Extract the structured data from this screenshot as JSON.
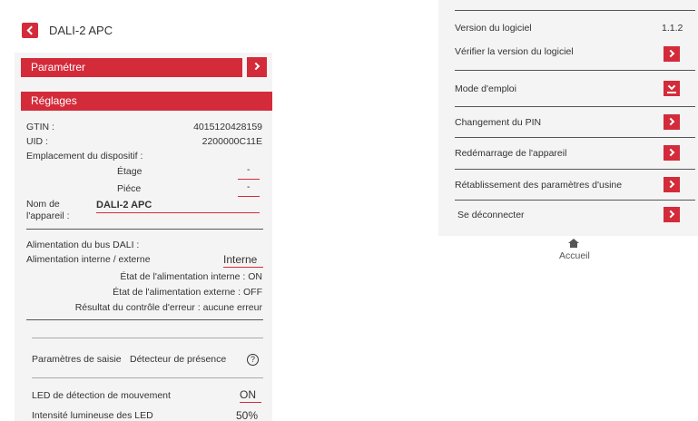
{
  "header": {
    "title": "DALI-2 APC"
  },
  "sections": {
    "parametrer": "Paramétrer",
    "reglages": "Réglages"
  },
  "info": {
    "gtin_label": "GTIN :",
    "gtin_value": "4015120428159",
    "uid_label": "UID :",
    "uid_value": "2200000C11E",
    "location_label": "Emplacement du dispositif :",
    "floor_label": "Étage",
    "floor_value": "-",
    "room_label": "Piéce",
    "room_value": "-",
    "name_label_1": "Nom de",
    "name_label_2": "l'appareil :",
    "name_value": "DALI-2 APC"
  },
  "power": {
    "bus_label": "Alimentation du bus DALI :",
    "mode_label": "Alimentation interne / externe",
    "mode_value": "Interne",
    "internal_state": "État de l'alimentation interne : ON",
    "external_state": "État de l'alimentation externe : OFF",
    "error_result": "Résultat du contrôle d'erreur : aucune erreur"
  },
  "input": {
    "params_label": "Paramètres de saisie",
    "detector_label": "Détecteur de présence",
    "help_symbol": "?"
  },
  "led": {
    "motion_label": "LED de détection de mouvement",
    "motion_value": "ON",
    "intensity_label": "Intensité lumineuse des LED",
    "intensity_value": "50%"
  },
  "right_panel": {
    "software_version_label": "Version du logiciel",
    "software_version_value": "1.1.2",
    "check_version": "Vérifier la version du logiciel",
    "manual": "Mode d'emploi",
    "change_pin": "Changement du PIN",
    "restart": "Redémarrage de l'appareil",
    "factory_reset": "Rétablissement des paramètres d'usine",
    "logout": "Se déconnecter"
  },
  "footer": {
    "home_label": "Accueil"
  },
  "colors": {
    "accent": "#d42b3a",
    "panel_bg": "#f4f4f4"
  },
  "icons": [
    "back-arrow-icon",
    "chevron-right-icon",
    "download-icon",
    "help-icon",
    "home-icon"
  ]
}
